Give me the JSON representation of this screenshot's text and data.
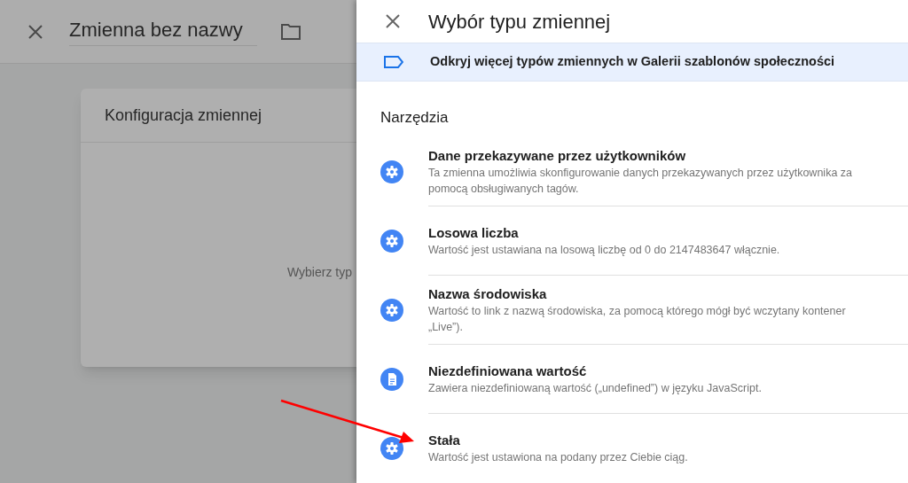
{
  "background": {
    "title": "Zmienna bez nazwy",
    "card": {
      "title": "Konfiguracja zmiennej",
      "hint": "Wybierz typ"
    }
  },
  "panel": {
    "title": "Wybór typu zmiennej",
    "banner": "Odkryj więcej typów zmiennych w Galerii szablonów społeczności",
    "section": "Narzędzia",
    "items": [
      {
        "kind": "gear",
        "title": "Dane przekazywane przez użytkowników",
        "lines": [
          "Ta zmienna umożliwia skonfigurowanie danych przekazywanych przez użytkownika za",
          "pomocą obsługiwanych tagów."
        ]
      },
      {
        "kind": "gear",
        "title": "Losowa liczba",
        "lines": [
          "Wartość jest ustawiana na losową liczbę od 0 do 2147483647 włącznie."
        ]
      },
      {
        "kind": "gear",
        "title": "Nazwa środowiska",
        "lines": [
          "Wartość to link z nazwą środowiska, za pomocą którego mógł być wczytany kontener",
          "„Live”)."
        ]
      },
      {
        "kind": "document",
        "title": "Niezdefiniowana wartość",
        "lines": [
          "Zawiera niezdefiniowaną wartość („undefined”) w języku JavaScript."
        ]
      },
      {
        "kind": "gear",
        "title": "Stała",
        "lines": [
          "Wartość jest ustawiona na podany przez Ciebie ciąg."
        ]
      }
    ]
  }
}
